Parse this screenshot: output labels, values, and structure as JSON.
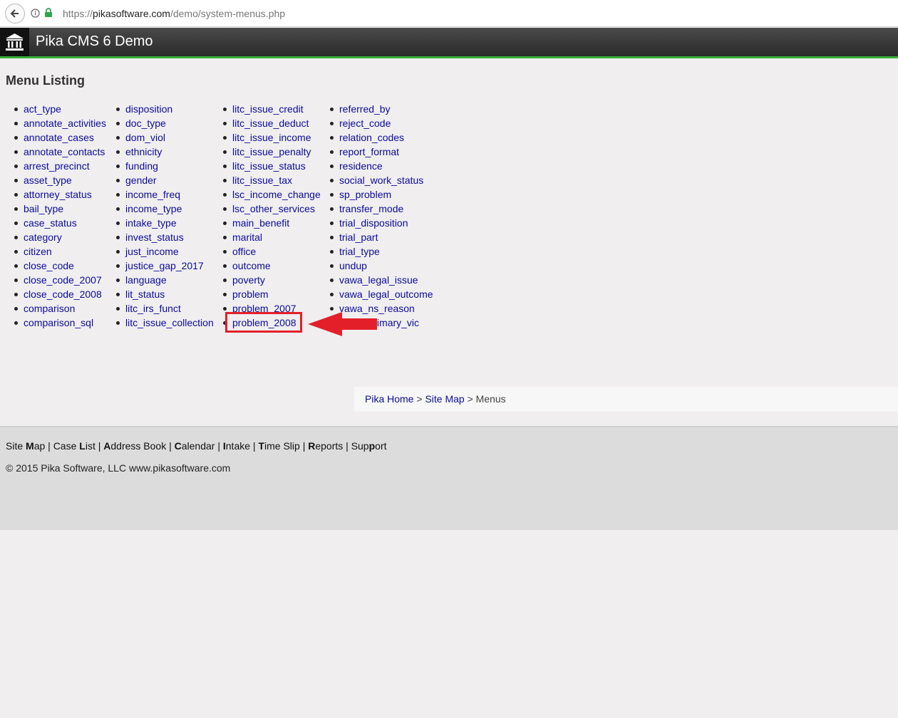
{
  "browser": {
    "url_prefix": "https://",
    "url_host": "pikasoftware.com",
    "url_path": "/demo/system-menus.php"
  },
  "app": {
    "title": "Pika CMS 6 Demo"
  },
  "page": {
    "title": "Menu Listing"
  },
  "menus": {
    "col1": [
      "act_type",
      "annotate_activities",
      "annotate_cases",
      "annotate_contacts",
      "arrest_precinct",
      "asset_type",
      "attorney_status",
      "bail_type",
      "case_status",
      "category",
      "citizen",
      "close_code",
      "close_code_2007",
      "close_code_2008",
      "comparison",
      "comparison_sql"
    ],
    "col2": [
      "disposition",
      "doc_type",
      "dom_viol",
      "ethnicity",
      "funding",
      "gender",
      "income_freq",
      "income_type",
      "intake_type",
      "invest_status",
      "just_income",
      "justice_gap_2017",
      "language",
      "lit_status",
      "litc_irs_funct",
      "litc_issue_collection"
    ],
    "col3": [
      "litc_issue_credit",
      "litc_issue_deduct",
      "litc_issue_income",
      "litc_issue_penalty",
      "litc_issue_status",
      "litc_issue_tax",
      "lsc_income_change",
      "lsc_other_services",
      "main_benefit",
      "marital",
      "office",
      "outcome",
      "poverty",
      "problem",
      "problem_2007",
      "problem_2008"
    ],
    "col4": [
      "referred_by",
      "reject_code",
      "relation_codes",
      "report_format",
      "residence",
      "social_work_status",
      "sp_problem",
      "transfer_mode",
      "trial_disposition",
      "trial_part",
      "trial_type",
      "undup",
      "vawa_legal_issue",
      "vawa_legal_outcome",
      "vawa_ns_reason",
      "vawa_primary_vic"
    ]
  },
  "annotation": {
    "highlighted_item": "problem_2008",
    "color": "#e3202a"
  },
  "breadcrumb": {
    "home": "Pika Home",
    "sep": ">",
    "site_map": "Site Map",
    "current": "Menus"
  },
  "footer": {
    "nav": [
      {
        "pre": "Site ",
        "key": "M",
        "post": "ap"
      },
      {
        "pre": "Case ",
        "key": "L",
        "post": "ist"
      },
      {
        "pre": "",
        "key": "A",
        "post": "ddress Book"
      },
      {
        "pre": "",
        "key": "C",
        "post": "alendar"
      },
      {
        "pre": "",
        "key": "I",
        "post": "ntake"
      },
      {
        "pre": "",
        "key": "T",
        "post": "ime Slip"
      },
      {
        "pre": "",
        "key": "R",
        "post": "eports"
      },
      {
        "pre": "Sup",
        "key": "p",
        "post": "ort"
      }
    ],
    "separator": "|",
    "copyright": "© 2015 Pika Software, LLC www.pikasoftware.com"
  },
  "colors": {
    "link": "#0b0b9a",
    "header_accent": "#3aae3a",
    "highlight": "#e3202a"
  }
}
